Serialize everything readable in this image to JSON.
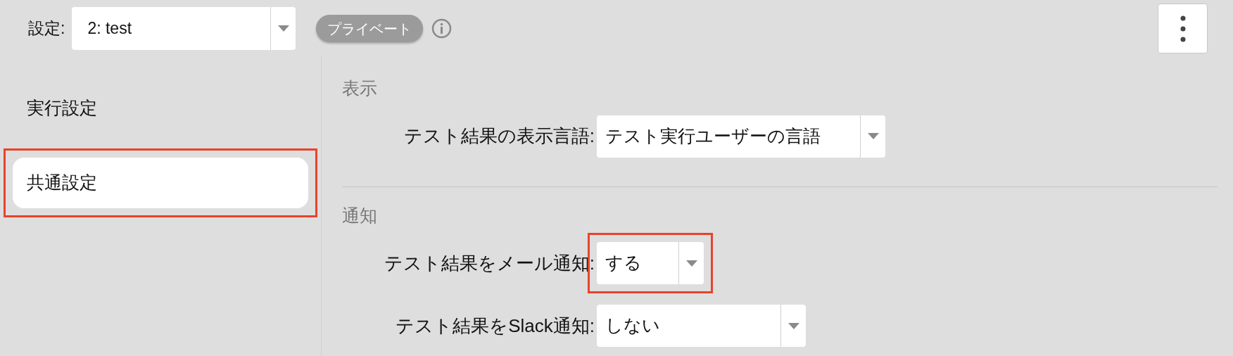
{
  "header": {
    "label": "設定:",
    "select": {
      "value": "2: test"
    },
    "badge": "プライベート"
  },
  "sidebar": {
    "items": [
      {
        "label": "実行設定",
        "selected": false,
        "highlighted": false
      },
      {
        "label": "共通設定",
        "selected": true,
        "highlighted": true
      }
    ]
  },
  "sections": [
    {
      "title": "表示",
      "fields": [
        {
          "label": "テスト結果の表示言語:",
          "value": "テスト実行ユーザーの言語",
          "highlighted": false
        }
      ]
    },
    {
      "title": "通知",
      "fields": [
        {
          "label": "テスト結果をメール通知:",
          "value": "する",
          "highlighted": true
        },
        {
          "label": "テスト結果をSlack通知:",
          "value": "しない",
          "highlighted": false
        }
      ]
    }
  ]
}
